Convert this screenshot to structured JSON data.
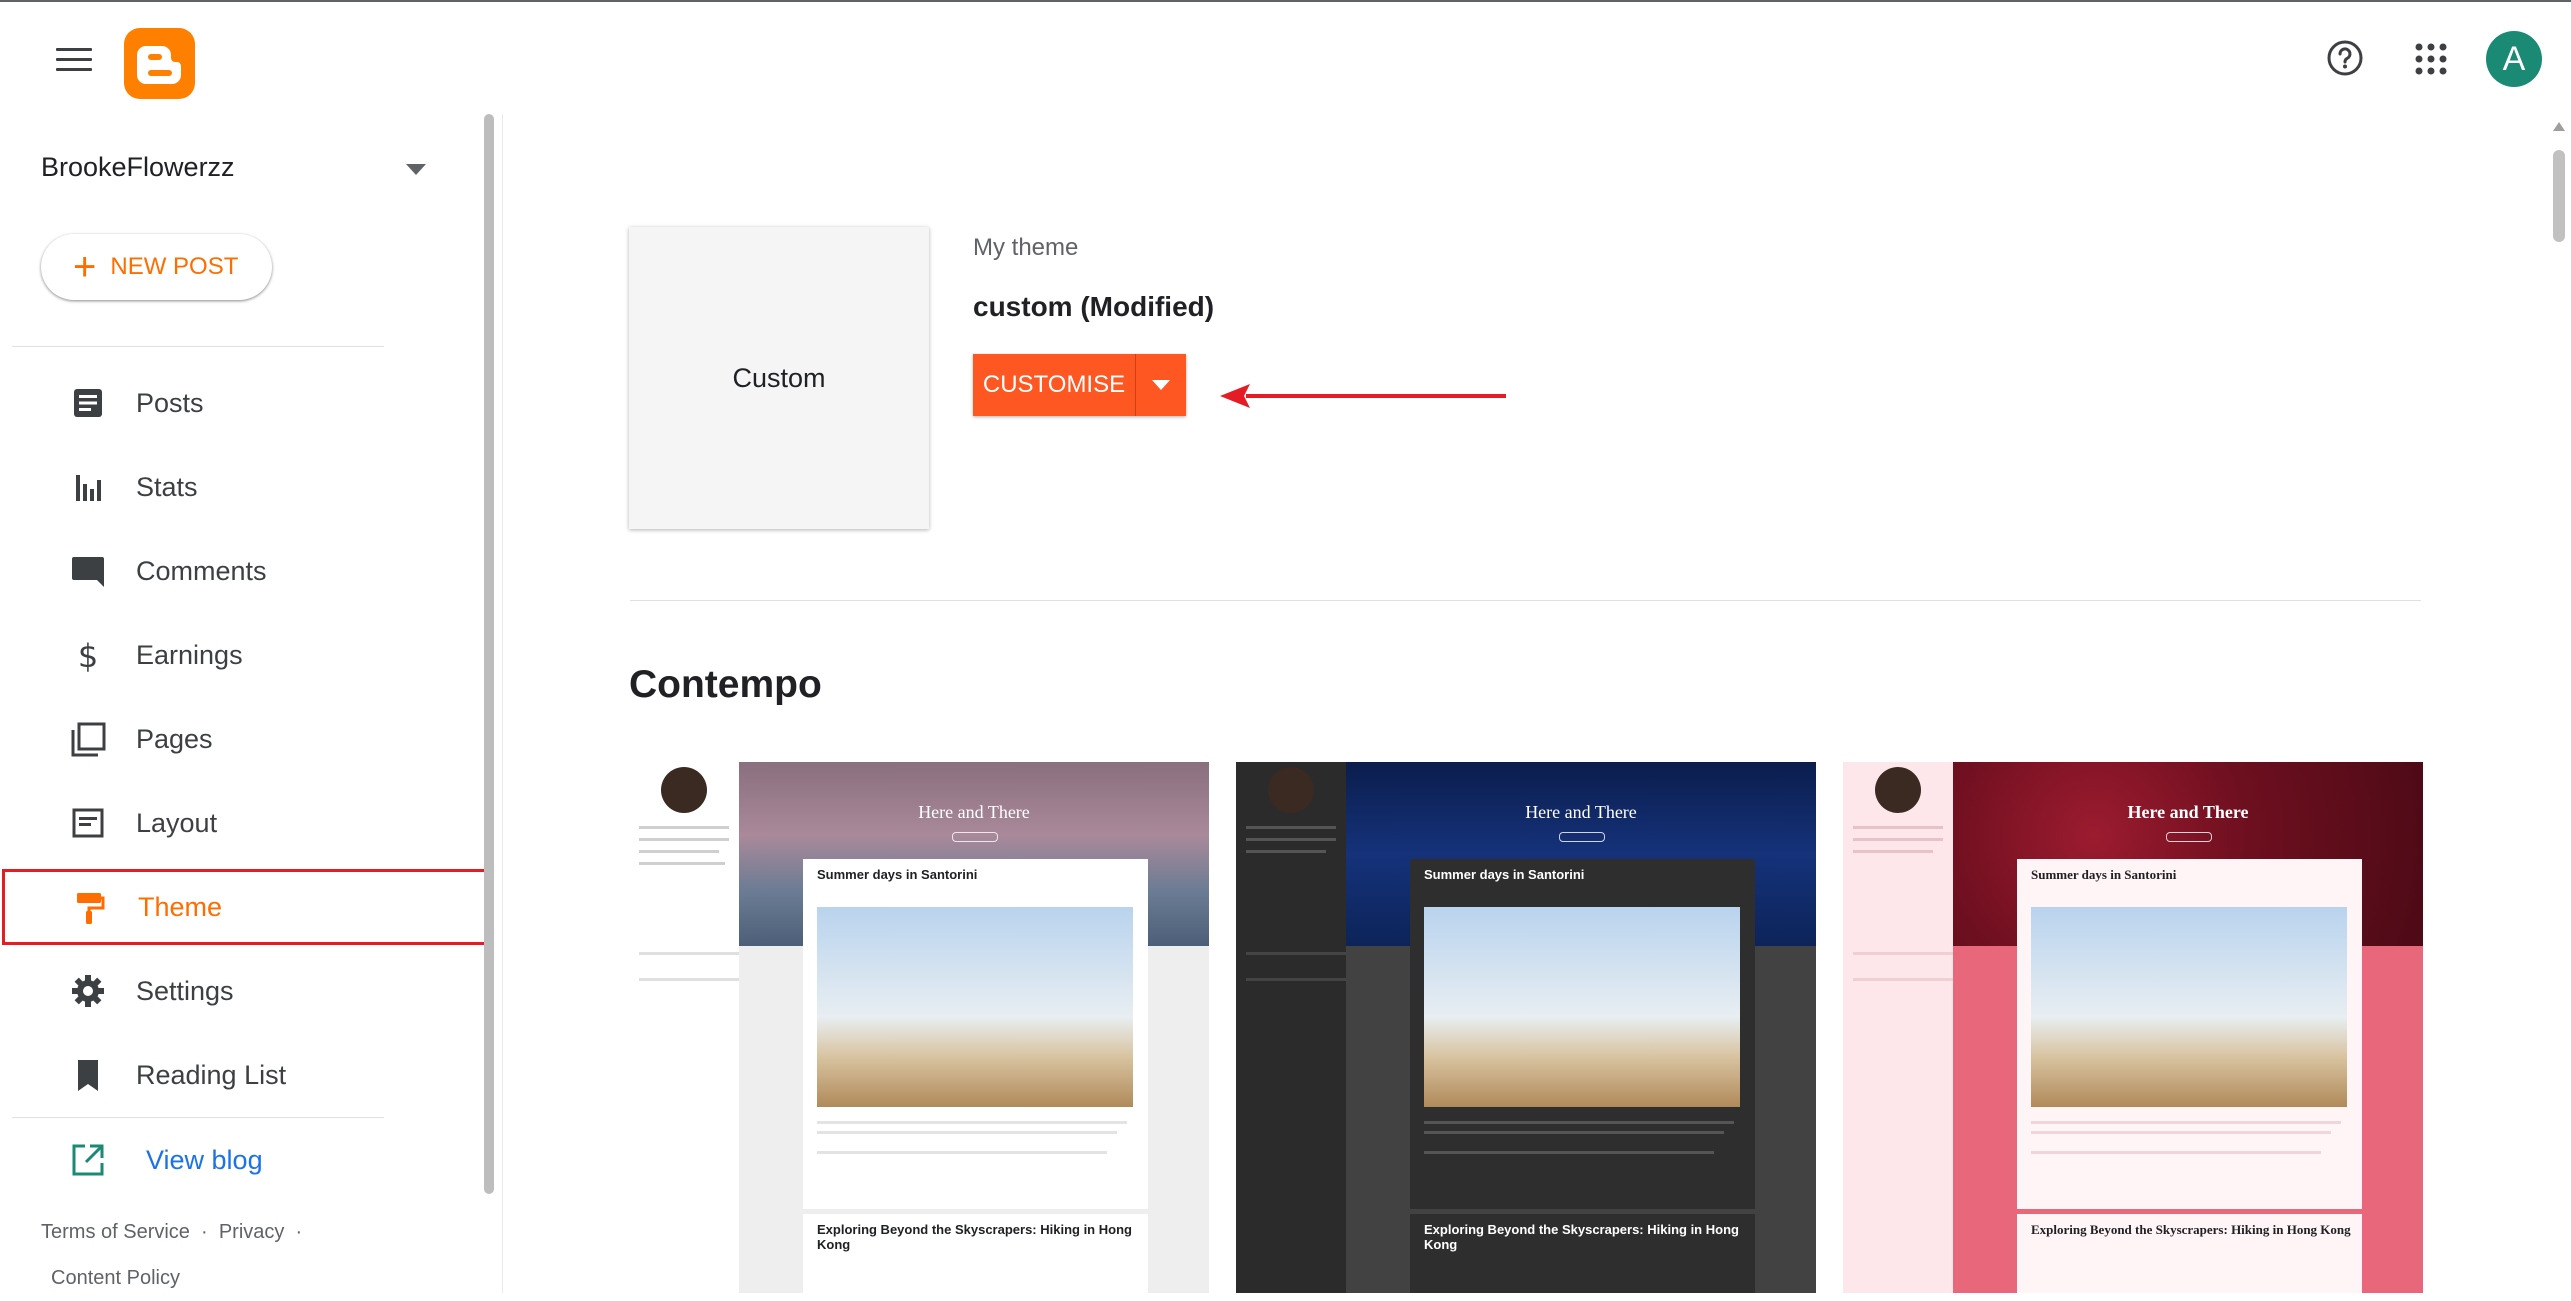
{
  "header": {
    "menu_icon": "hamburger-menu-icon",
    "logo": "blogger-logo",
    "help_icon": "help-icon",
    "apps_icon": "apps-grid-icon",
    "avatar_letter": "A",
    "avatar_color": "#1a8a74"
  },
  "sidebar": {
    "blog_name": "BrookeFlowerzz",
    "new_post_label": "NEW POST",
    "items": [
      {
        "label": "Posts",
        "icon": "posts-icon"
      },
      {
        "label": "Stats",
        "icon": "stats-icon"
      },
      {
        "label": "Comments",
        "icon": "comments-icon"
      },
      {
        "label": "Earnings",
        "icon": "dollar-icon"
      },
      {
        "label": "Pages",
        "icon": "pages-icon"
      },
      {
        "label": "Layout",
        "icon": "layout-icon"
      },
      {
        "label": "Theme",
        "icon": "paint-roller-icon",
        "active": true
      },
      {
        "label": "Settings",
        "icon": "gear-icon"
      },
      {
        "label": "Reading List",
        "icon": "bookmark-icon"
      }
    ],
    "view_blog_label": "View blog",
    "footer": {
      "terms": "Terms of Service",
      "privacy": "Privacy",
      "content_policy": "Content Policy"
    }
  },
  "main": {
    "current_theme": {
      "thumbnail_label": "Custom",
      "section_label": "My theme",
      "name": "custom (Modified)",
      "customise_label": "CUSTOMISE"
    },
    "gallery": {
      "title": "Contempo",
      "previews": [
        {
          "blog_title": "Here and There",
          "post1_title": "Summer days in Santorini",
          "post2_title": "Exploring Beyond the Skyscrapers: Hiking in Hong Kong",
          "variant": "light"
        },
        {
          "blog_title": "Here and There",
          "post1_title": "Summer days in Santorini",
          "post2_title": "Exploring Beyond the Skyscrapers: Hiking in Hong Kong",
          "variant": "dark"
        },
        {
          "blog_title": "Here and There",
          "post1_title": "Summer days in Santorini",
          "post2_title": "Exploring Beyond the Skyscrapers: Hiking in Hong Kong",
          "variant": "pink"
        }
      ]
    }
  },
  "colors": {
    "accent": "#ff6d00",
    "button": "#ff5722",
    "highlight_border": "#e51c23",
    "link": "#1a73e8"
  }
}
